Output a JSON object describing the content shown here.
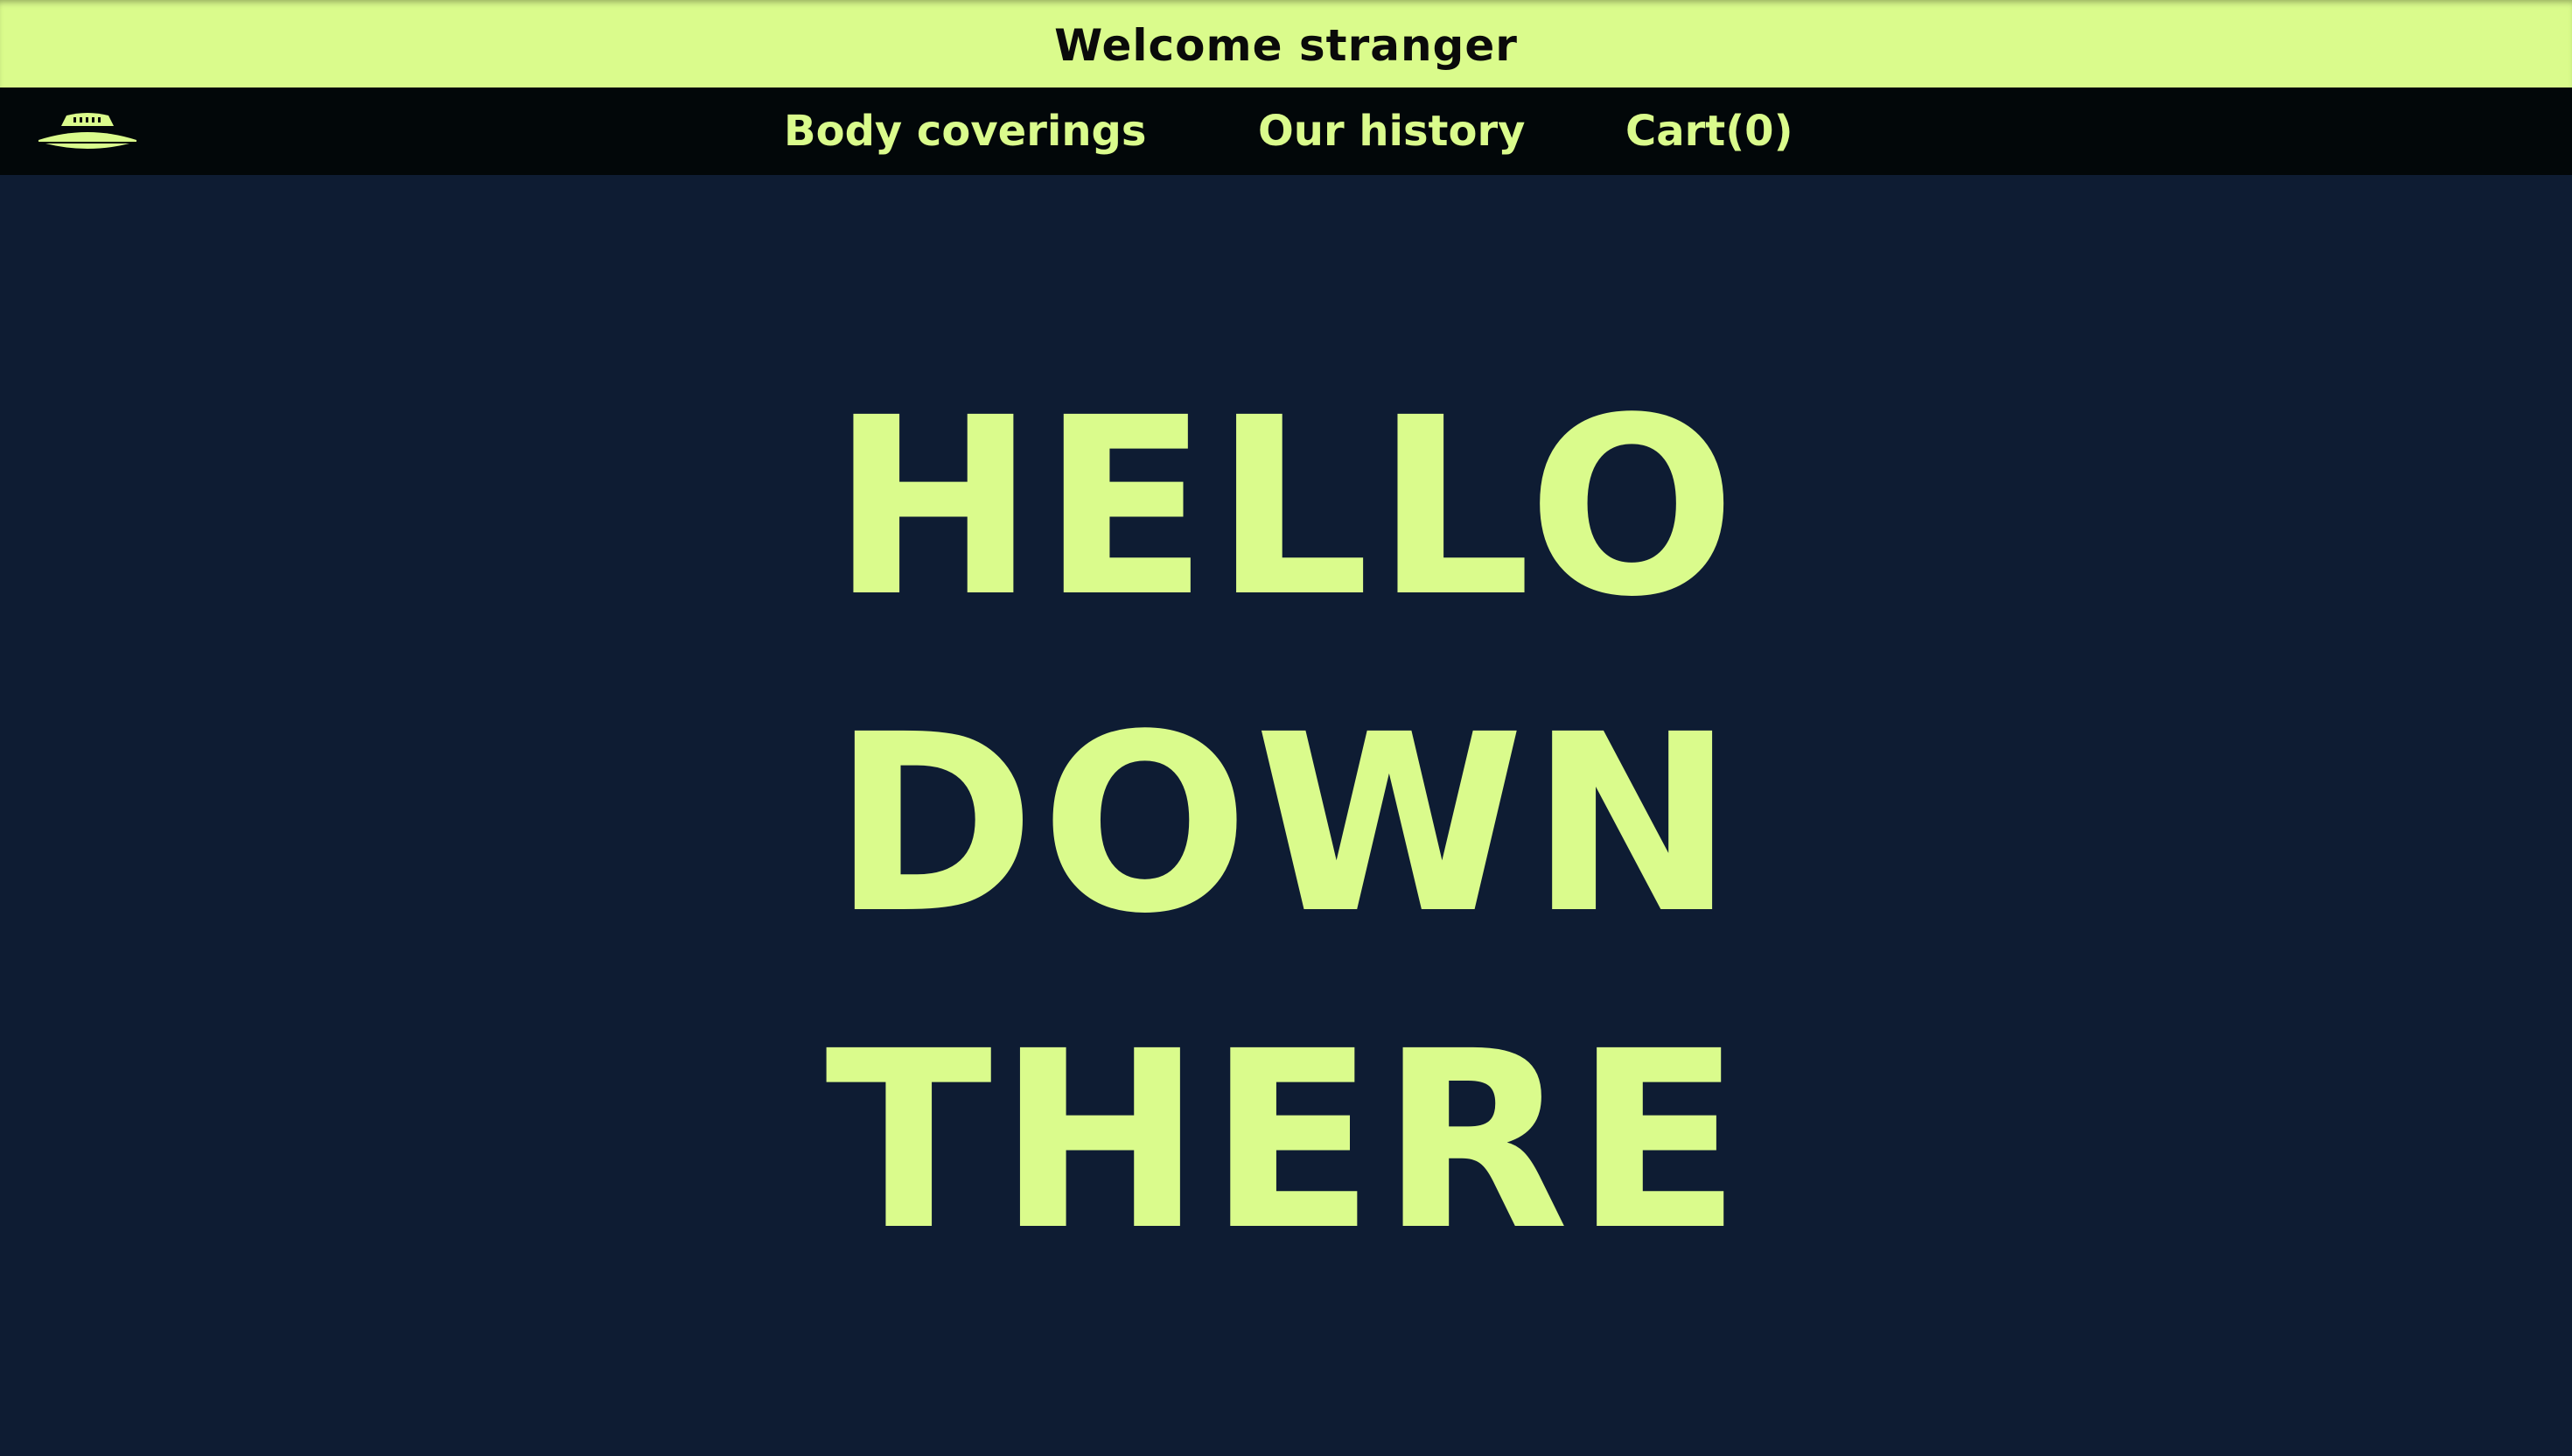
{
  "banner": {
    "text": "Welcome stranger"
  },
  "nav": {
    "logo_icon": "ufo-icon",
    "items": [
      {
        "label": "Body coverings"
      },
      {
        "label": "Our history"
      },
      {
        "label": "Cart(0)"
      }
    ]
  },
  "hero": {
    "lines": [
      "HELLO",
      "DOWN",
      "THERE"
    ]
  },
  "colors": {
    "accent": "#dafb8c",
    "background": "#0e1c33",
    "navbar": "#020709",
    "banner_text": "#0a0a0a"
  }
}
